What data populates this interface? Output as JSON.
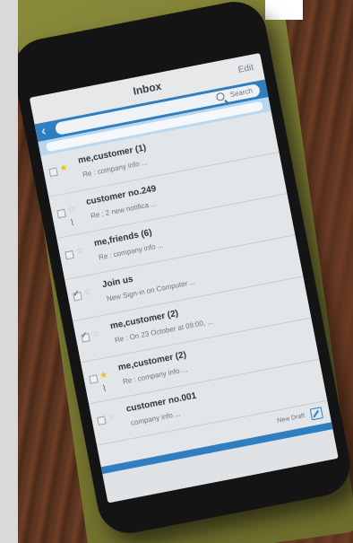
{
  "screen": {
    "title": "Inbox",
    "edit_label": "Edit",
    "back_icon": "chevron-left",
    "search_label": "Search",
    "search_icon": "search",
    "compose_label": "New Draft",
    "compose_icon": "compose"
  },
  "messages": [
    {
      "sender": "me,customer (1)",
      "preview": "Re : company info ...",
      "starred": true,
      "checked": false,
      "attachment": false
    },
    {
      "sender": "customer no.249",
      "preview": "Re : 2 new notifica ...",
      "starred": false,
      "checked": false,
      "attachment": true
    },
    {
      "sender": "me,friends (6)",
      "preview": "Re : company info ...",
      "starred": false,
      "checked": false,
      "attachment": false
    },
    {
      "sender": "Join us",
      "preview": "New Sign-in on Computer ...",
      "starred": false,
      "checked": true,
      "attachment": false
    },
    {
      "sender": "me,customer (2)",
      "preview": "Re : On 23 October at 09:00, ...",
      "starred": false,
      "checked": true,
      "attachment": false
    },
    {
      "sender": "me,customer (2)",
      "preview": "Re : company info ...",
      "starred": true,
      "checked": false,
      "attachment": true
    },
    {
      "sender": "customer no.001",
      "preview": "company info ...",
      "starred": false,
      "checked": false,
      "attachment": false
    }
  ],
  "colors": {
    "accent": "#2f7fc0",
    "star_active": "#e3c21a"
  }
}
